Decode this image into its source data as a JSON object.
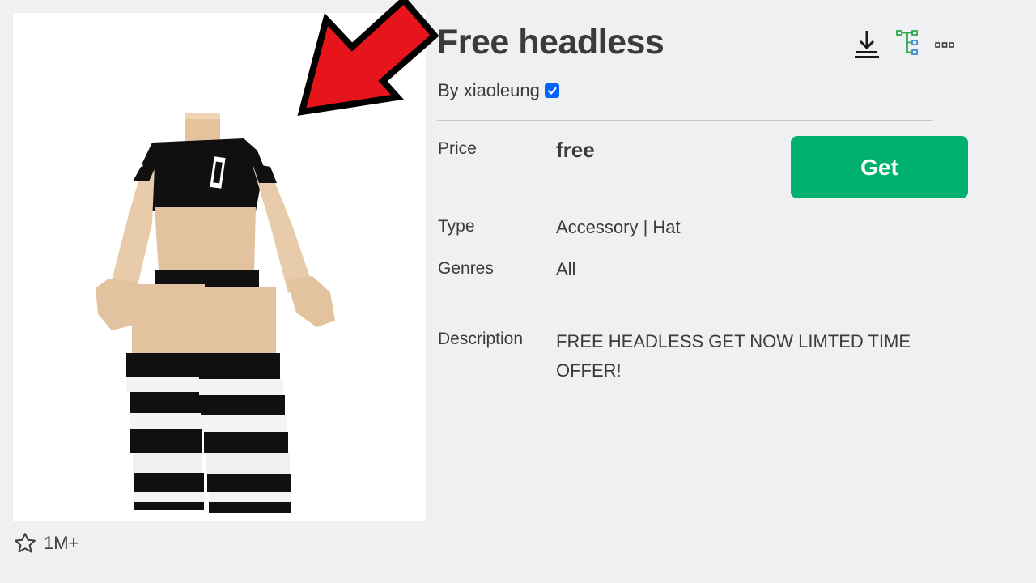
{
  "item": {
    "title": "Free headless",
    "by_prefix": "By",
    "creator": "xiaoleung",
    "favorites": "1M+"
  },
  "details": {
    "price_label": "Price",
    "price_value": "free",
    "type_label": "Type",
    "type_value": "Accessory | Hat",
    "genres_label": "Genres",
    "genres_value": "All",
    "description_label": "Description",
    "description_value": "FREE HEADLESS GET NOW LIMTED TIME OFFER!"
  },
  "actions": {
    "get_label": "Get"
  },
  "icons": {
    "download": "download-icon",
    "try_on": "avatar-tree-icon",
    "more": "more-options-icon",
    "favorite": "star-icon",
    "verified": "verified-badge-icon"
  },
  "colors": {
    "background": "#eff0f2",
    "get_button": "#00b06f",
    "arrow": "#e8141b",
    "verified": "#0066ff",
    "text": "#393b3d"
  }
}
